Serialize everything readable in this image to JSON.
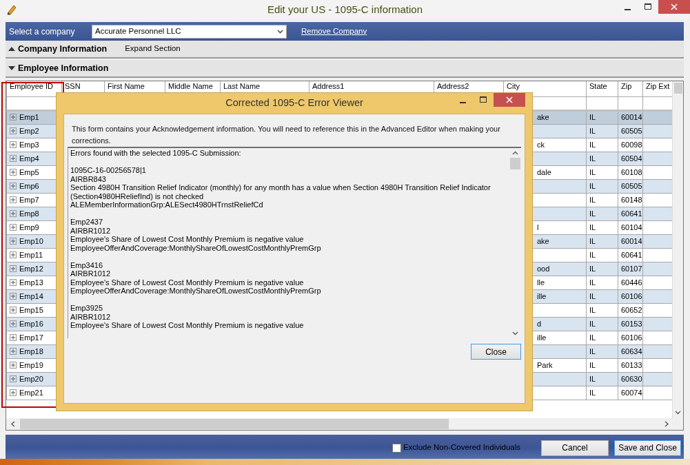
{
  "window": {
    "title": "Edit your US - 1095-C information"
  },
  "company_bar": {
    "label": "Select a company",
    "company": "Accurate Personnel LLC",
    "remove_link": "Remove Company"
  },
  "sections": [
    {
      "title": "Company Information",
      "expanded": false,
      "link": "Expand Section"
    },
    {
      "title": "Employee Information",
      "expanded": true
    }
  ],
  "table": {
    "columns": [
      "Employee ID",
      "SSN",
      "First Name",
      "Middle Name",
      "Last Name",
      "Address1",
      "Address2",
      "City",
      "State",
      "Zip",
      "Zip Ext"
    ],
    "rows": [
      {
        "employee_id": "Emp1",
        "city": "ake",
        "state": "IL",
        "zip": "60014",
        "selected": true
      },
      {
        "employee_id": "Emp2",
        "state": "IL",
        "zip": "60505",
        "selected": false
      },
      {
        "employee_id": "Emp3",
        "city": "ck",
        "state": "IL",
        "zip": "60098",
        "selected": false
      },
      {
        "employee_id": "Emp4",
        "state": "IL",
        "zip": "60504",
        "selected": false
      },
      {
        "employee_id": "Emp5",
        "city": "dale",
        "state": "IL",
        "zip": "60108",
        "selected": false
      },
      {
        "employee_id": "Emp6",
        "state": "IL",
        "zip": "60505",
        "selected": false
      },
      {
        "employee_id": "Emp7",
        "state": "IL",
        "zip": "60148",
        "selected": false
      },
      {
        "employee_id": "Emp8",
        "state": "IL",
        "zip": "60641",
        "selected": false
      },
      {
        "employee_id": "Emp9",
        "city": "l",
        "state": "IL",
        "zip": "60104",
        "selected": false
      },
      {
        "employee_id": "Emp10",
        "city": "ake",
        "state": "IL",
        "zip": "60014",
        "selected": false
      },
      {
        "employee_id": "Emp11",
        "state": "IL",
        "zip": "60641",
        "selected": false
      },
      {
        "employee_id": "Emp12",
        "city": "ood",
        "state": "IL",
        "zip": "60107",
        "selected": false
      },
      {
        "employee_id": "Emp13",
        "city": "lle",
        "state": "IL",
        "zip": "60446",
        "selected": false
      },
      {
        "employee_id": "Emp14",
        "city": "ille",
        "state": "IL",
        "zip": "60106",
        "selected": false
      },
      {
        "employee_id": "Emp15",
        "state": "IL",
        "zip": "60652",
        "selected": false
      },
      {
        "employee_id": "Emp16",
        "city": "d",
        "state": "IL",
        "zip": "60153",
        "selected": false
      },
      {
        "employee_id": "Emp17",
        "city": "ille",
        "state": "IL",
        "zip": "60106",
        "selected": false
      },
      {
        "employee_id": "Emp18",
        "state": "IL",
        "zip": "60634",
        "selected": false
      },
      {
        "employee_id": "Emp19",
        "city": "Park",
        "state": "IL",
        "zip": "60133",
        "selected": false
      },
      {
        "employee_id": "Emp20",
        "state": "IL",
        "zip": "60630",
        "selected": false
      },
      {
        "employee_id": "Emp21",
        "state": "IL",
        "zip": "60074",
        "selected": false
      }
    ]
  },
  "footer": {
    "checkbox": {
      "label": "Exclude Non-Covered Individuals",
      "checked": false
    },
    "buttons": [
      "Cancel",
      "Save and Close"
    ]
  },
  "dialog": {
    "title": "Corrected 1095-C Error Viewer",
    "intro": "This form contains your Acknowledgement information. You will need to reference this in the Advanced Editor when making your corrections.",
    "error_groups": [
      [
        "Errors found with the selected 1095-C Submission:"
      ],
      [
        "1095C-16-00256578|1",
        "AIRBR843",
        "Section 4980H Transition Relief Indicator (monthly) for any month has a value when Section 4980H Transition Relief Indicator (Section4980HReliefInd) is not checked",
        "ALEMemberInformationGrp:ALESect4980HTrnstReliefCd"
      ],
      [
        "Emp2437",
        "AIRBR1012",
        "Employee's Share of Lowest Cost Monthly Premium is negative value",
        "EmployeeOfferAndCoverage:MonthlyShareOfLowestCostMonthlyPremGrp"
      ],
      [
        "Emp3416",
        "AIRBR1012",
        "Employee's Share of Lowest Cost Monthly Premium is negative value",
        "EmployeeOfferAndCoverage:MonthlyShareOfLowestCostMonthlyPremGrp"
      ],
      [
        "Emp3925",
        "AIRBR1012",
        "Employee's Share of Lowest Cost Monthly Premium is negative value"
      ]
    ],
    "button": "Close"
  }
}
